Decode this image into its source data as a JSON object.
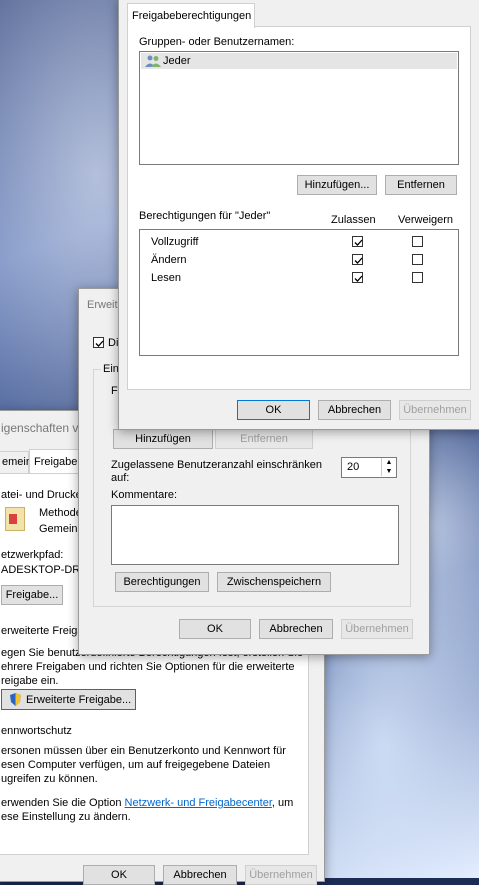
{
  "props_window": {
    "title": "igenschaften v",
    "tabs": [
      "emein",
      "Freigabe"
    ],
    "section_printers": "atei- und Drucke",
    "method_label": "Methode",
    "shared_label": "Gemeins",
    "network_path_label": "etzwerkpfad:",
    "network_path_value": "ADESKTOP-DRM",
    "share_button": "Freigabe...",
    "advanced_title": "erweiterte Freigab",
    "advanced_text_1": "egen Sie benutzerdefinierte Berechtigungen fest, erstellen Sie",
    "advanced_text_2": "ehrere Freigaben und richten Sie Optionen für die erweiterte",
    "advanced_text_3": "reigabe ein.",
    "advanced_button": "Erweiterte Freigabe...",
    "password_title": "ennwortschutz",
    "password_text_1": "ersonen müssen über ein Benutzerkonto und Kennwort für",
    "password_text_2": "esen Computer verfügen, um auf freigegebene Dateien",
    "password_text_3": "ugreifen zu können.",
    "password_text_4_pre": "erwenden Sie die Option ",
    "password_link": "Netzwerk- und Freigabecenter",
    "password_text_4_post": ", um",
    "password_text_5": "ese Einstellung zu ändern.",
    "ok": "OK",
    "cancel": "Abbrechen",
    "apply": "Übernehmen"
  },
  "adv_window": {
    "title": "Erweit",
    "share_checkbox_label": "Di",
    "settings_group": "Eins",
    "share_name_label": "Fr",
    "add_button": "Hinzufügen",
    "remove_button": "Entfernen",
    "limit_label_1": "Zugelassene Benutzeranzahl einschränken",
    "limit_label_2": "auf:",
    "limit_value": "20",
    "comments_label": "Kommentare:",
    "permissions_button": "Berechtigungen",
    "cache_button": "Zwischenspeichern",
    "ok": "OK",
    "cancel": "Abbrechen",
    "apply": "Übernehmen"
  },
  "perm_window": {
    "tab": "Freigabeberechtigungen",
    "groups_label": "Gruppen- oder Benutzernamen:",
    "groups": [
      "Jeder"
    ],
    "add_button": "Hinzufügen...",
    "remove_button": "Entfernen",
    "perms_for": "Berechtigungen für \"Jeder\"",
    "allow_header": "Zulassen",
    "deny_header": "Verweigern",
    "permissions": [
      {
        "name": "Vollzugriff",
        "allow": true,
        "deny": false
      },
      {
        "name": "Ändern",
        "allow": true,
        "deny": false
      },
      {
        "name": "Lesen",
        "allow": true,
        "deny": false
      }
    ],
    "ok": "OK",
    "cancel": "Abbrechen",
    "apply": "Übernehmen"
  }
}
